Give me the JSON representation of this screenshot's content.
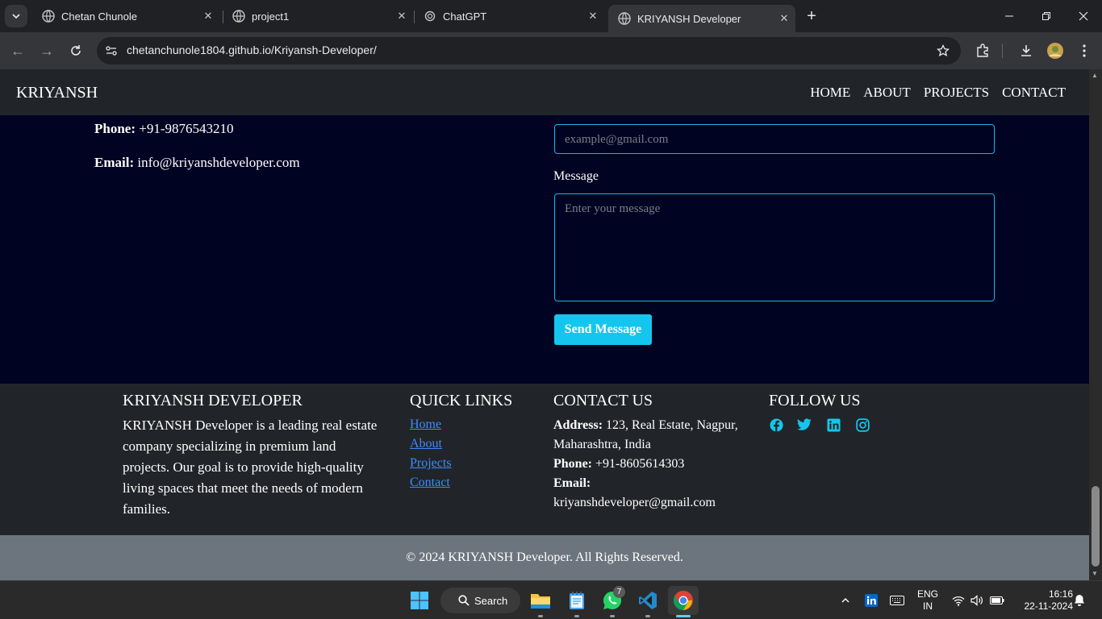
{
  "browser": {
    "tabs": [
      {
        "title": "Chetan Chunole",
        "active": false
      },
      {
        "title": "project1",
        "active": false
      },
      {
        "title": "ChatGPT",
        "active": false
      },
      {
        "title": "KRIYANSH Developer",
        "active": true
      }
    ],
    "url": "chetanchunole1804.github.io/Kriyansh-Developer/"
  },
  "site": {
    "brand": "KRIYANSH",
    "nav": [
      "HOME",
      "ABOUT",
      "PROJECTS",
      "CONTACT"
    ],
    "contact_info": {
      "phone_label": "Phone:",
      "phone": "+91-9876543210",
      "email_label": "Email:",
      "email": "info@kriyanshdeveloper.com"
    },
    "form": {
      "email_placeholder": "example@gmail.com",
      "message_label": "Message",
      "message_placeholder": "Enter your message",
      "send_label": "Send Message"
    },
    "footer": {
      "about_heading": "KRIYANSH DEVELOPER",
      "about_text_lines": [
        "KRIYANSH Developer is a leading real estate",
        "company specializing in premium land",
        "projects. Our goal is to provide high-quality",
        "living spaces that meet the needs of modern",
        "families."
      ],
      "links_heading": "QUICK LINKS",
      "links": [
        "Home",
        "About",
        "Projects",
        "Contact"
      ],
      "contact_heading": "CONTACT US",
      "address_label": "Address:",
      "address_line1": "123, Real Estate, Nagpur,",
      "address_line2": "Maharashtra, India",
      "phone_label": "Phone:",
      "phone": "+91-8605614303",
      "email_label": "Email:",
      "email": "kriyanshdeveloper@gmail.com",
      "follow_heading": "FOLLOW US",
      "social_icons": [
        "facebook-icon",
        "twitter-icon",
        "linkedin-icon",
        "instagram-icon"
      ],
      "copyright": "© 2024 KRIYANSH Developer. All Rights Reserved."
    },
    "colors": {
      "accent": "#14c6ee",
      "background": "#000322",
      "nav": "#212529",
      "footer_bottom": "#6c757d"
    }
  },
  "taskbar": {
    "search_label": "Search",
    "whatsapp_badge": "7",
    "lang_line1": "ENG",
    "lang_line2": "IN",
    "time": "16:16",
    "date": "22-11-2024"
  }
}
